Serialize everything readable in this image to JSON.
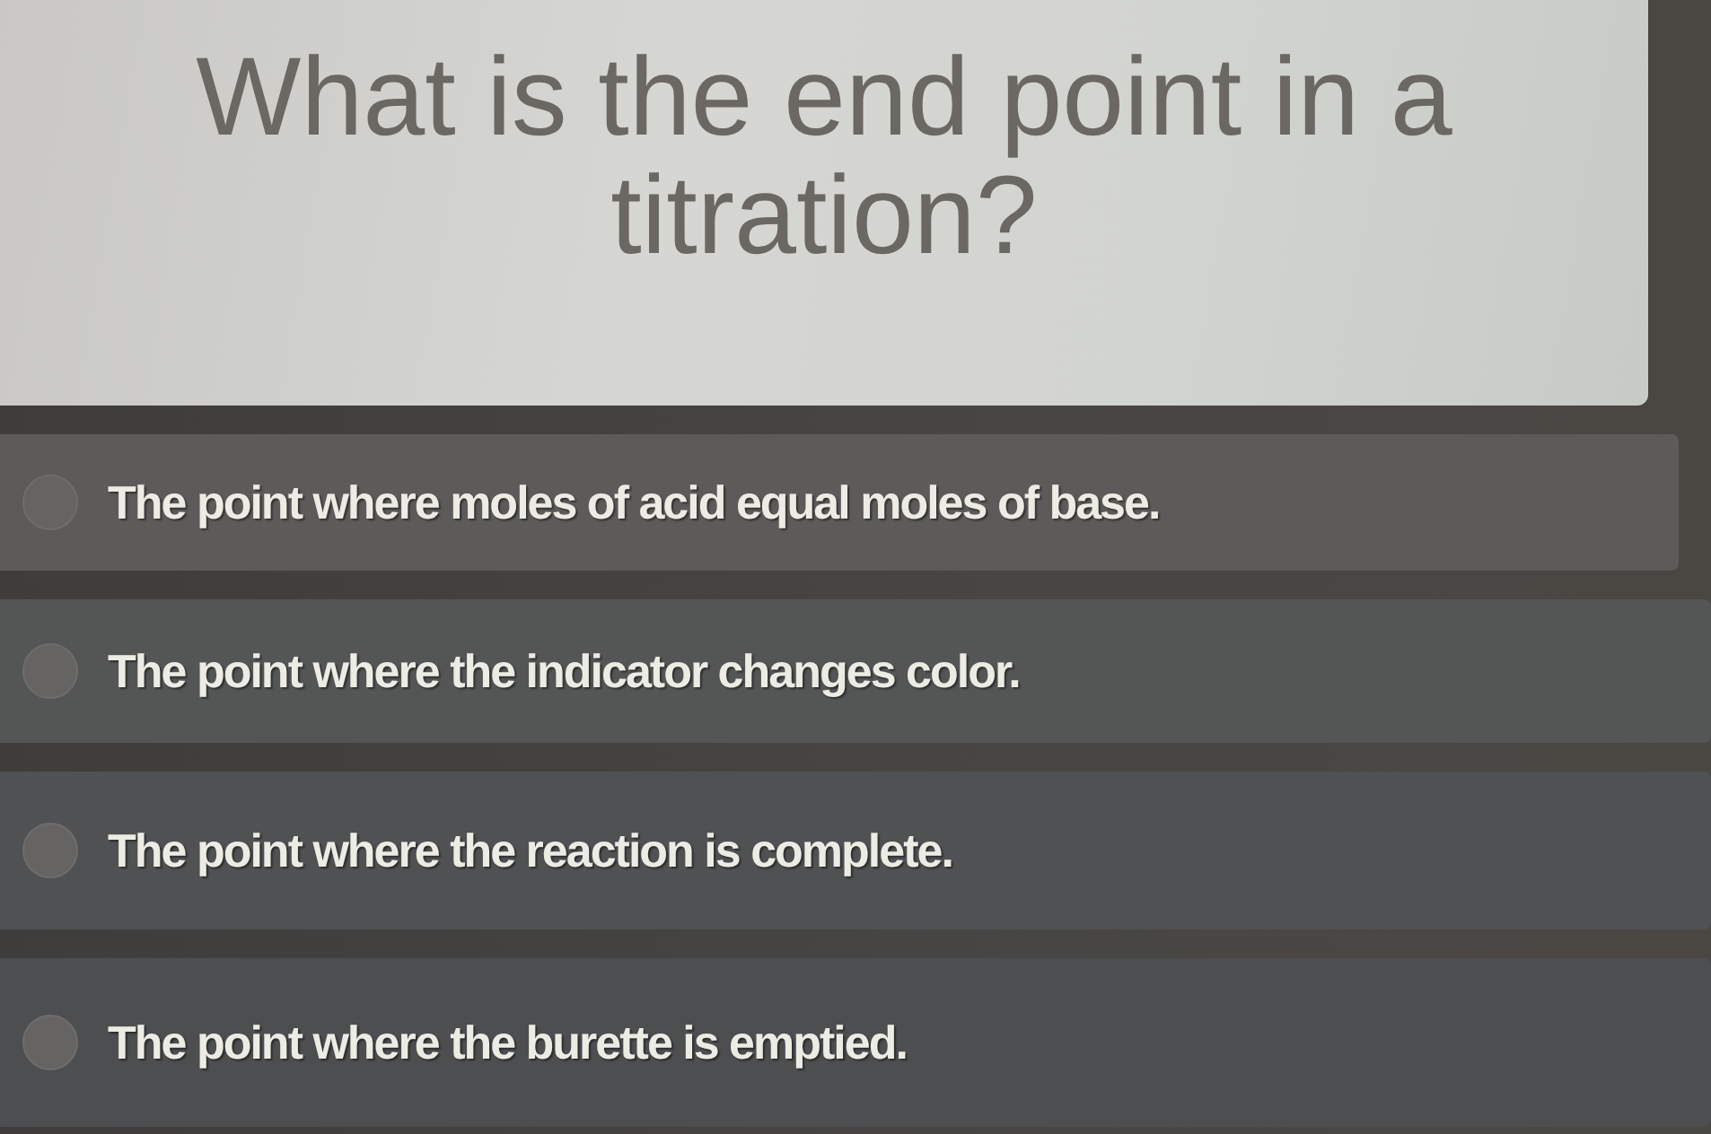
{
  "question": {
    "text": "What is the end point in a titration?"
  },
  "options": [
    {
      "text": "The point where moles of acid equal moles of base.",
      "selected": false
    },
    {
      "text": "The point where the indicator changes color.",
      "selected": false
    },
    {
      "text": "The point where the reaction is complete.",
      "selected": false
    },
    {
      "text": "The point where the burette is emptied.",
      "selected": false
    }
  ]
}
